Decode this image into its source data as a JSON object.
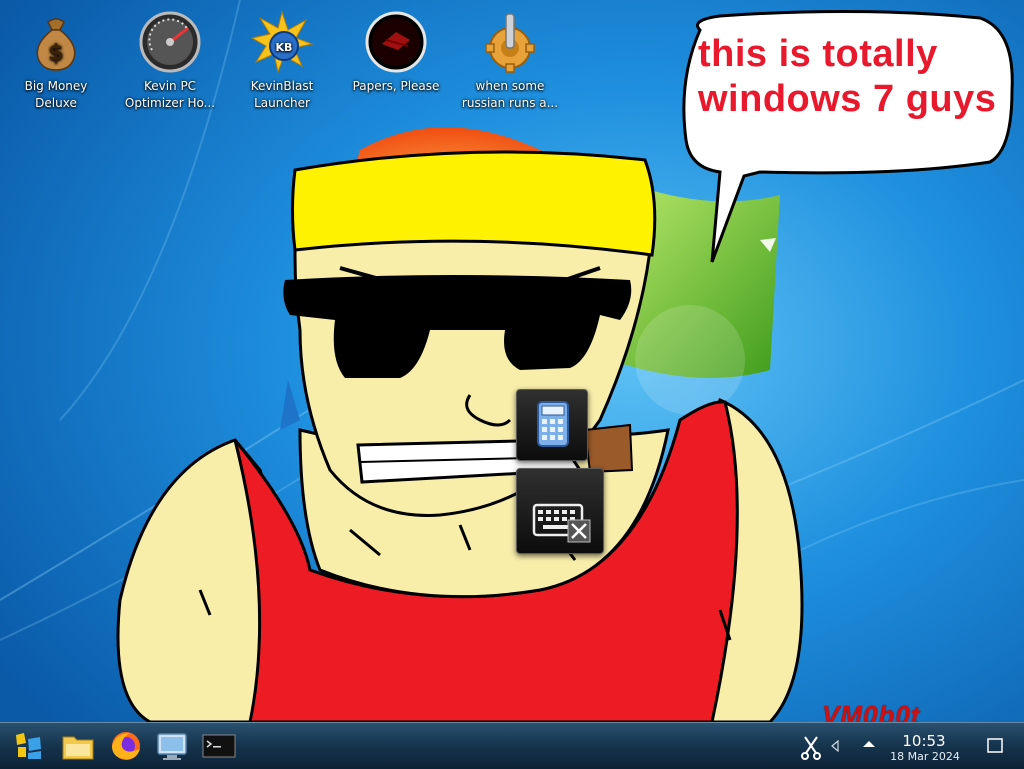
{
  "desktop": {
    "icons": [
      {
        "label": "Big Money Deluxe",
        "icon": "money-bag-icon"
      },
      {
        "label": "Kevin PC Optimizer Ho...",
        "icon": "gauge-icon"
      },
      {
        "label": "KevinBlast Launcher",
        "icon": "starburst-disc-icon"
      },
      {
        "label": "Papers, Please",
        "icon": "papers-please-icon"
      },
      {
        "label": "when some russian runs a...",
        "icon": "gear-lever-icon"
      }
    ],
    "speech_bubble": {
      "line1": "this is totally",
      "line2": "windows 7 guys"
    },
    "watermark": "VM0b0t"
  },
  "dock": {
    "items": [
      {
        "icon": "calculator-icon"
      },
      {
        "icon": "keyboard-close-icon"
      }
    ]
  },
  "taskbar": {
    "buttons": [
      {
        "icon": "start-menu-icon"
      },
      {
        "icon": "file-manager-icon"
      },
      {
        "icon": "firefox-icon"
      },
      {
        "icon": "remote-desktop-icon"
      },
      {
        "icon": "terminal-icon"
      }
    ],
    "tray": {
      "icons": [
        "scissors-icon",
        "volume-icon",
        "tray-expand-icon",
        "show-desktop-icon"
      ],
      "time": "10:53",
      "date": "18 Mar 2024"
    }
  },
  "colors": {
    "bubble_text": "#e8192c",
    "watermark": "#d01010",
    "taskbar": "#173650"
  }
}
